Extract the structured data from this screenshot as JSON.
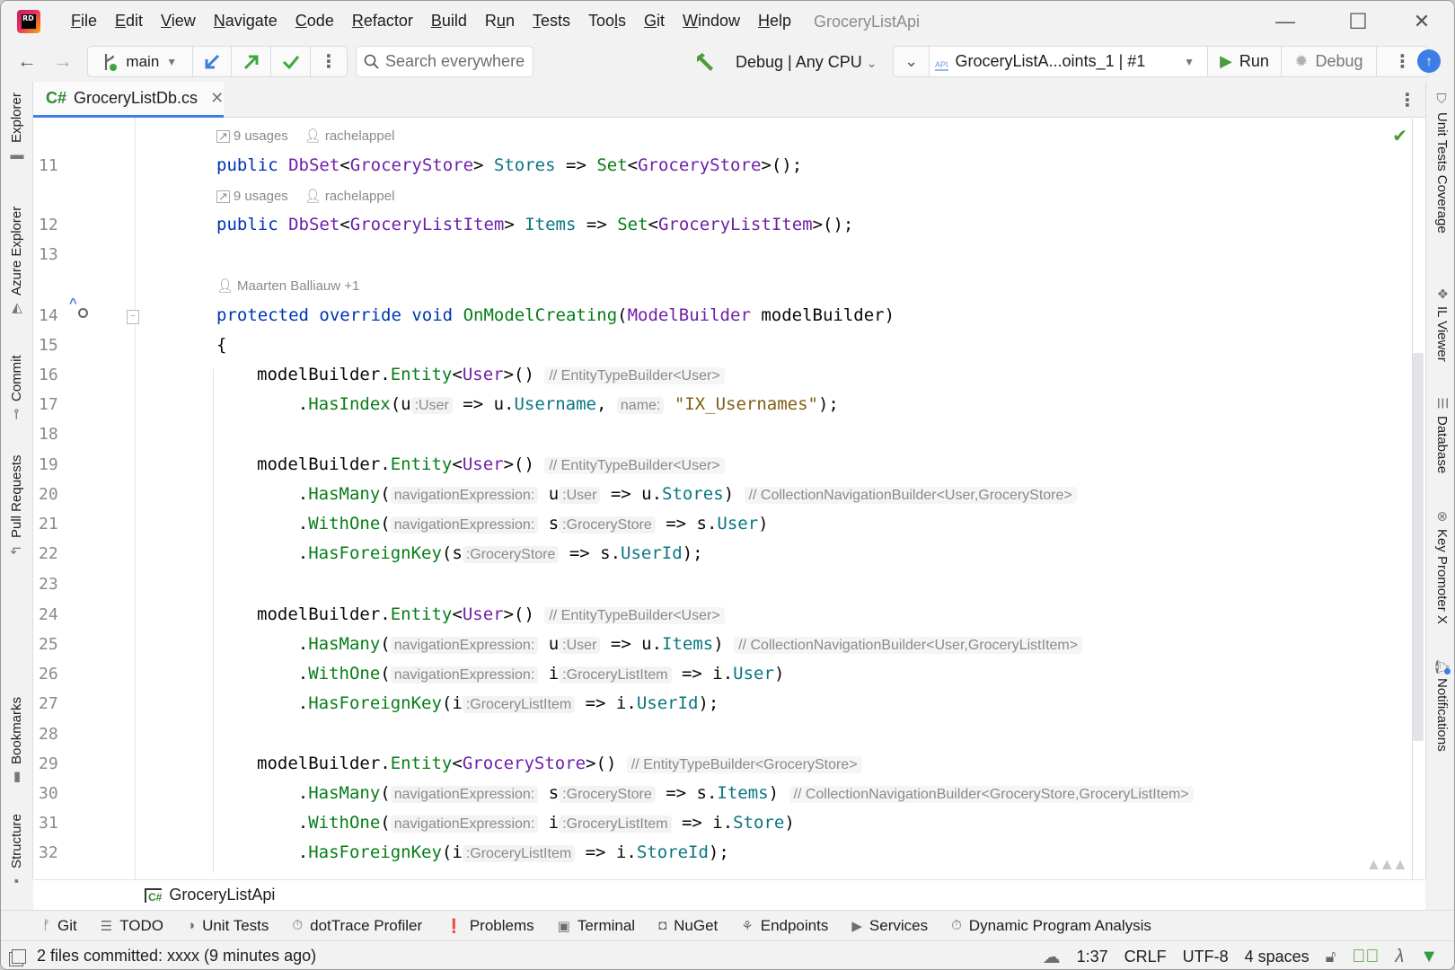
{
  "app": {
    "logo_text": "RD",
    "window_title": "GroceryListApi"
  },
  "menu": [
    {
      "label": "File",
      "mnemonic": "F",
      "rest": "ile"
    },
    {
      "label": "Edit",
      "mnemonic": "E",
      "rest": "dit"
    },
    {
      "label": "View",
      "mnemonic": "V",
      "rest": "iew"
    },
    {
      "label": "Navigate",
      "mnemonic": "N",
      "rest": "avigate"
    },
    {
      "label": "Code",
      "mnemonic": "C",
      "rest": "ode"
    },
    {
      "label": "Refactor",
      "mnemonic": "R",
      "rest": "efactor"
    },
    {
      "label": "Build",
      "mnemonic": "B",
      "rest": "uild"
    },
    {
      "label": "Run",
      "mnemonic": "u",
      "pre": "R",
      "rest": "n"
    },
    {
      "label": "Tests",
      "mnemonic": "T",
      "rest": "ests"
    },
    {
      "label": "Tools",
      "pre": "Too",
      "mnemonic": "l",
      "rest": "s"
    },
    {
      "label": "Git",
      "mnemonic": "G",
      "rest": "it"
    },
    {
      "label": "Window",
      "mnemonic": "W",
      "rest": "indow"
    },
    {
      "label": "Help",
      "mnemonic": "H",
      "rest": "elp"
    }
  ],
  "window_controls": {
    "minimize": "—",
    "maximize": "☐",
    "close": "✕"
  },
  "toolbar": {
    "back": "←",
    "forward": "→",
    "branch": "main",
    "search_placeholder": "Search everywhere",
    "configuration": "Debug | Any CPU",
    "run_config": "GroceryListA...oints_1 | #1",
    "run_label": "Run",
    "debug_label": "Debug"
  },
  "left_stripe": [
    "Explorer",
    "Azure Explorer",
    "Commit",
    "Pull Requests",
    "Bookmarks",
    "Structure"
  ],
  "right_stripe": [
    "Unit Tests Coverage",
    "IL Viewer",
    "Database",
    "Key Promoter X",
    "Notifications"
  ],
  "editor": {
    "tab": {
      "lang": "C#",
      "filename": "GroceryListDb.cs"
    },
    "lenses": {
      "l11_usages": "9 usages",
      "l11_author": "rachelappel",
      "l12_usages": "9 usages",
      "l12_author": "rachelappel",
      "l14_author": "Maarten Balliauw +1"
    },
    "line_numbers": [
      "11",
      "12",
      "13",
      "14",
      "15",
      "16",
      "17",
      "18",
      "19",
      "20",
      "21",
      "22",
      "23",
      "24",
      "25",
      "26",
      "27",
      "28",
      "29",
      "30",
      "31",
      "32"
    ],
    "hints": {
      "etb_user": "// EntityTypeBuilder<User>",
      "etb_store": "// EntityTypeBuilder<GroceryStore>",
      "cnb_user_store": "// CollectionNavigationBuilder<User,GroceryStore>",
      "cnb_user_item": "// CollectionNavigationBuilder<User,GroceryListItem>",
      "cnb_store_item": "// CollectionNavigationBuilder<GroceryStore,GroceryListItem>",
      "nav_expr": "navigationExpression:",
      "t_user": ":User",
      "t_store": ":GroceryStore",
      "t_item": ":GroceryListItem",
      "name": "name:"
    }
  },
  "breadcrumb": {
    "project": "GroceryListApi"
  },
  "tool_windows": [
    "Git",
    "TODO",
    "Unit Tests",
    "dotTrace Profiler",
    "Problems",
    "Terminal",
    "NuGet",
    "Endpoints",
    "Services",
    "Dynamic Program Analysis"
  ],
  "status": {
    "message": "2 files committed: xxxx (9 minutes ago)",
    "position": "1:37",
    "line_ending": "CRLF",
    "encoding": "UTF-8",
    "indent": "4 spaces"
  }
}
